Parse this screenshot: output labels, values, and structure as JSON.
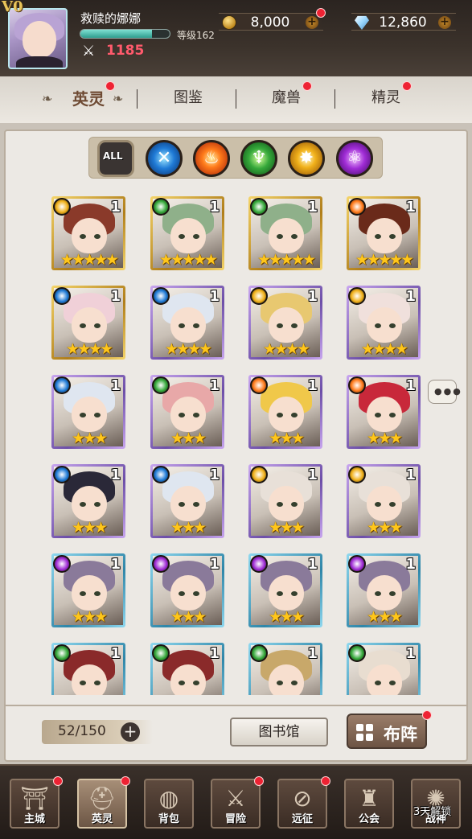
{
  "player": {
    "vip_label": "V0",
    "name": "救赎的娜娜",
    "level_label": "等级162",
    "xp_fraction": 0.8,
    "power": "1185"
  },
  "currency": {
    "gold": "8,000",
    "gems": "12,860"
  },
  "tabs": [
    {
      "label": "英灵",
      "active": true,
      "badge": true
    },
    {
      "label": "图鉴",
      "active": false,
      "badge": false
    },
    {
      "label": "魔兽",
      "active": false,
      "badge": true
    },
    {
      "label": "精灵",
      "active": false,
      "badge": true
    }
  ],
  "filters": [
    {
      "name": "all",
      "label": "ALL"
    },
    {
      "name": "water",
      "icon": "water-element-icon"
    },
    {
      "name": "fire",
      "icon": "fire-element-icon"
    },
    {
      "name": "wood",
      "icon": "wood-element-icon"
    },
    {
      "name": "light",
      "icon": "light-element-icon"
    },
    {
      "name": "dark",
      "icon": "dark-element-icon"
    }
  ],
  "heroes": [
    {
      "element": "light",
      "frame": "gold",
      "count": "1",
      "stars": 5,
      "hair": "#8a3a2a"
    },
    {
      "element": "wood",
      "frame": "gold",
      "count": "1",
      "stars": 5,
      "hair": "#8fb08a"
    },
    {
      "element": "wood",
      "frame": "gold",
      "count": "1",
      "stars": 5,
      "hair": "#8fb08a"
    },
    {
      "element": "fire",
      "frame": "gold",
      "count": "1",
      "stars": 5,
      "hair": "#6a2a1a"
    },
    {
      "element": "water",
      "frame": "gold",
      "count": "1",
      "stars": 4,
      "hair": "#f0d0d8"
    },
    {
      "element": "water",
      "frame": "purple",
      "count": "1",
      "stars": 4,
      "hair": "#dfe6f0"
    },
    {
      "element": "light",
      "frame": "purple",
      "count": "1",
      "stars": 4,
      "hair": "#e8c870"
    },
    {
      "element": "light",
      "frame": "purple",
      "count": "1",
      "stars": 4,
      "hair": "#f0e0dc"
    },
    {
      "element": "water",
      "frame": "purple",
      "count": "1",
      "stars": 3,
      "hair": "#dfe6f0"
    },
    {
      "element": "wood",
      "frame": "purple",
      "count": "1",
      "stars": 3,
      "hair": "#e8a8a8"
    },
    {
      "element": "fire",
      "frame": "purple",
      "count": "1",
      "stars": 3,
      "hair": "#f0c84a"
    },
    {
      "element": "fire",
      "frame": "purple",
      "count": "1",
      "stars": 3,
      "hair": "#c8283a"
    },
    {
      "element": "water",
      "frame": "purple",
      "count": "1",
      "stars": 3,
      "hair": "#2a2838"
    },
    {
      "element": "water",
      "frame": "purple",
      "count": "1",
      "stars": 3,
      "hair": "#dfe6f0"
    },
    {
      "element": "light",
      "frame": "purple",
      "count": "1",
      "stars": 3,
      "hair": "#e8e0d8"
    },
    {
      "element": "light",
      "frame": "purple",
      "count": "1",
      "stars": 3,
      "hair": "#e8e0d8"
    },
    {
      "element": "dark",
      "frame": "blue",
      "count": "1",
      "stars": 3,
      "hair": "#8a7a9a"
    },
    {
      "element": "dark",
      "frame": "blue",
      "count": "1",
      "stars": 3,
      "hair": "#8a7a9a"
    },
    {
      "element": "dark",
      "frame": "blue",
      "count": "1",
      "stars": 3,
      "hair": "#8a7a9a"
    },
    {
      "element": "dark",
      "frame": "blue",
      "count": "1",
      "stars": 3,
      "hair": "#8a7a9a"
    },
    {
      "element": "wood",
      "frame": "blue",
      "count": "1",
      "stars": 3,
      "hair": "#8a2a2a"
    },
    {
      "element": "wood",
      "frame": "blue",
      "count": "1",
      "stars": 3,
      "hair": "#8a2a2a"
    },
    {
      "element": "wood",
      "frame": "blue",
      "count": "1",
      "stars": 3,
      "hair": "#c8a86a"
    },
    {
      "element": "wood",
      "frame": "blue",
      "count": "1",
      "stars": 3,
      "hair": "#e8ddd0"
    }
  ],
  "capacity": "52/150",
  "buttons": {
    "library": "图书馆",
    "formation": "布阵"
  },
  "nav": [
    {
      "label": "主城",
      "icon": "city-gate-icon",
      "badge": true,
      "active": false
    },
    {
      "label": "英灵",
      "icon": "hero-helmet-icon",
      "badge": true,
      "active": true
    },
    {
      "label": "背包",
      "icon": "backpack-icon",
      "badge": false,
      "active": false
    },
    {
      "label": "冒险",
      "icon": "crossed-swords-icon",
      "badge": true,
      "active": false
    },
    {
      "label": "远征",
      "icon": "compass-icon",
      "badge": true,
      "active": false
    },
    {
      "label": "公会",
      "icon": "castle-icon",
      "badge": false,
      "active": false
    },
    {
      "label": "战神",
      "icon": "war-god-icon",
      "badge": false,
      "active": false
    }
  ],
  "unlock_text": "3天解锁",
  "colors": {
    "water": "#1f7ad6",
    "fire": "#ff7a1a",
    "wood": "#35a83a",
    "light": "#f1b11a",
    "dark": "#a02cd6",
    "badge_red": "#ee2233",
    "power_red": "#ff5a6c"
  }
}
